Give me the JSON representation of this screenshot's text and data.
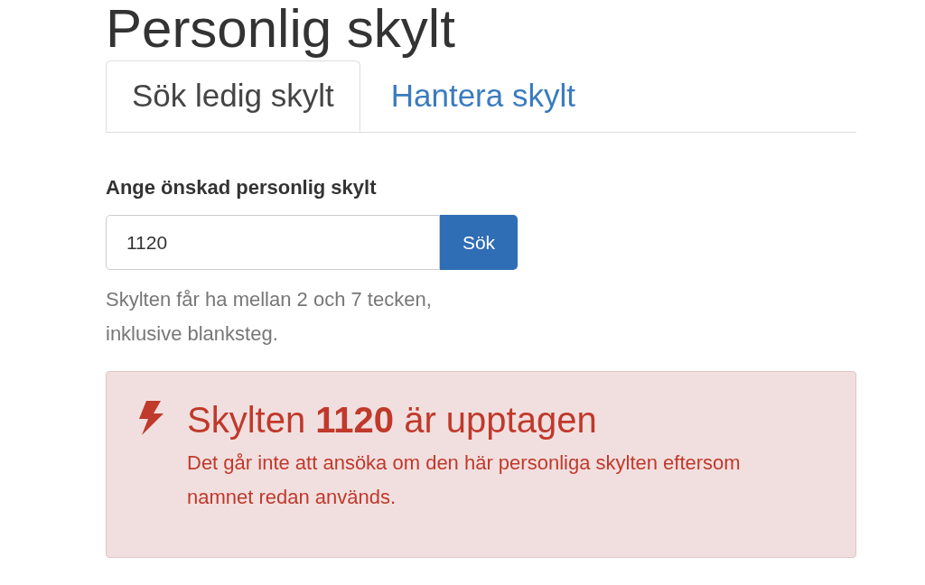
{
  "title": "Personlig skylt",
  "tabs": [
    {
      "label": "Sök ledig skylt",
      "selected": true
    },
    {
      "label": "Hantera skylt",
      "selected": false
    }
  ],
  "field": {
    "label": "Ange önskad personlig skylt",
    "value": "1120",
    "button": "Sök",
    "help": "Skylten får ha mellan 2 och 7 tecken, inklusive blanksteg."
  },
  "alert": {
    "kind": "error",
    "heading": "Skylten **1120** är upptagen",
    "message": "Det går inte att ansöka om den här personliga skylten eftersom namnet redan används."
  }
}
